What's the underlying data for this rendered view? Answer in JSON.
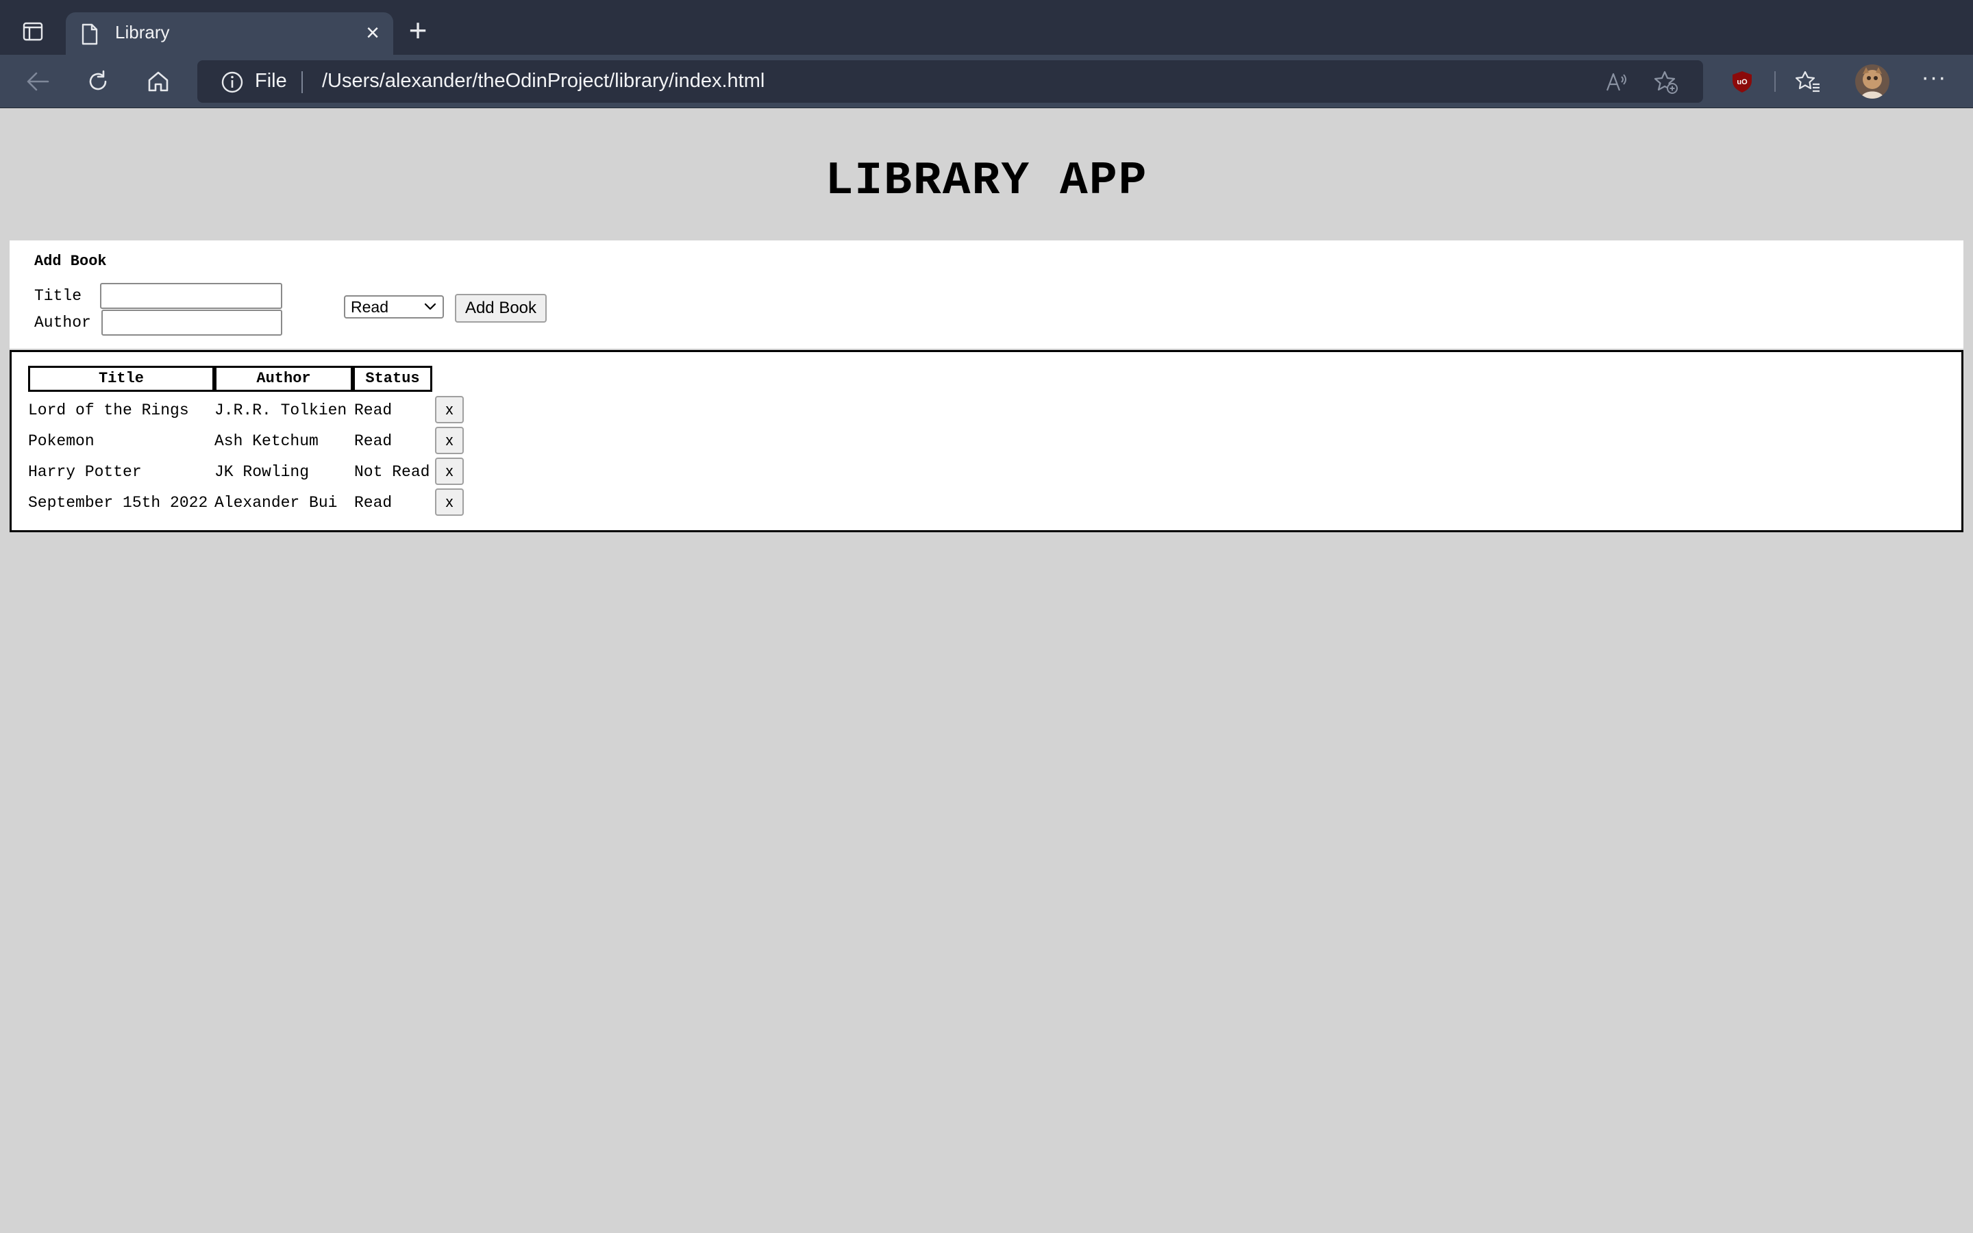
{
  "browser": {
    "tab": {
      "title": "Library",
      "close_label": "×"
    },
    "new_tab_label": "+",
    "address": {
      "scheme": "File",
      "url": "/Users/alexander/theOdinProject/library/index.html"
    },
    "more_label": "···"
  },
  "page": {
    "title": "LIBRARY APP",
    "form": {
      "heading": "Add Book",
      "title_label": "Title",
      "author_label": "Author",
      "title_value": "",
      "author_value": "",
      "status_selected": "Read",
      "submit_label": "Add Book"
    },
    "table": {
      "headers": [
        "Title",
        "Author",
        "Status"
      ],
      "delete_label": "x",
      "rows": [
        {
          "title": "Lord of the Rings",
          "author": "J.R.R. Tolkien",
          "status": "Read"
        },
        {
          "title": "Pokemon",
          "author": "Ash Ketchum",
          "status": "Read"
        },
        {
          "title": "Harry Potter",
          "author": "JK Rowling",
          "status": "Not Read"
        },
        {
          "title": "September 15th 2022",
          "author": "Alexander Bui",
          "status": "Read"
        }
      ]
    }
  }
}
